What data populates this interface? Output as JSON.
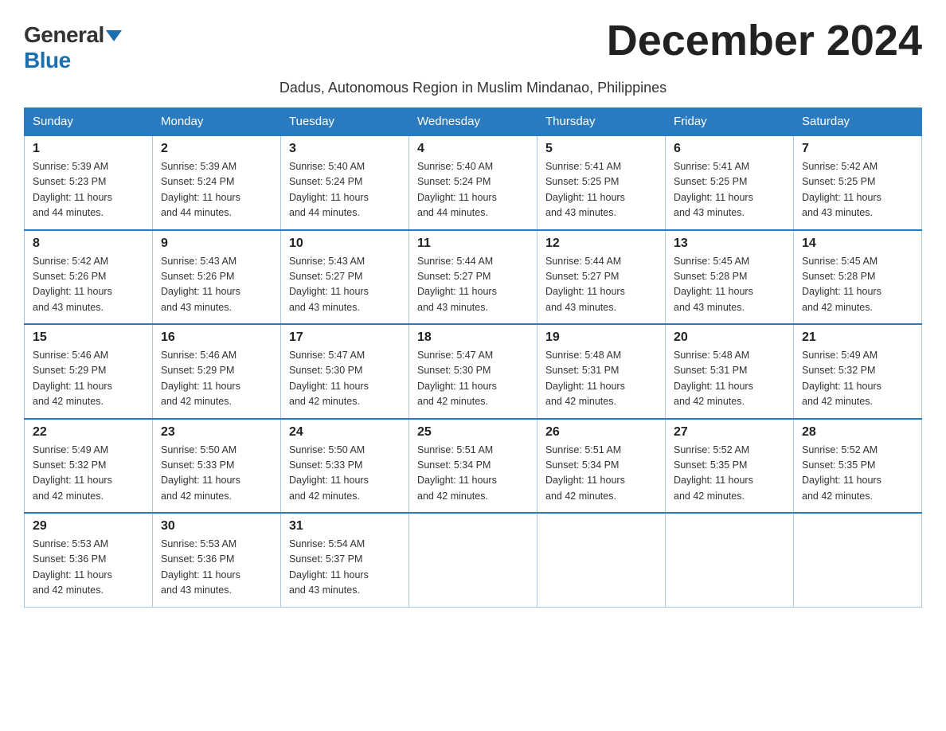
{
  "header": {
    "logo_general": "General",
    "logo_blue": "Blue",
    "month_title": "December 2024",
    "subtitle": "Dadus, Autonomous Region in Muslim Mindanao, Philippines"
  },
  "weekdays": [
    "Sunday",
    "Monday",
    "Tuesday",
    "Wednesday",
    "Thursday",
    "Friday",
    "Saturday"
  ],
  "weeks": [
    [
      {
        "day": "1",
        "sunrise": "5:39 AM",
        "sunset": "5:23 PM",
        "daylight": "11 hours and 44 minutes."
      },
      {
        "day": "2",
        "sunrise": "5:39 AM",
        "sunset": "5:24 PM",
        "daylight": "11 hours and 44 minutes."
      },
      {
        "day": "3",
        "sunrise": "5:40 AM",
        "sunset": "5:24 PM",
        "daylight": "11 hours and 44 minutes."
      },
      {
        "day": "4",
        "sunrise": "5:40 AM",
        "sunset": "5:24 PM",
        "daylight": "11 hours and 44 minutes."
      },
      {
        "day": "5",
        "sunrise": "5:41 AM",
        "sunset": "5:25 PM",
        "daylight": "11 hours and 43 minutes."
      },
      {
        "day": "6",
        "sunrise": "5:41 AM",
        "sunset": "5:25 PM",
        "daylight": "11 hours and 43 minutes."
      },
      {
        "day": "7",
        "sunrise": "5:42 AM",
        "sunset": "5:25 PM",
        "daylight": "11 hours and 43 minutes."
      }
    ],
    [
      {
        "day": "8",
        "sunrise": "5:42 AM",
        "sunset": "5:26 PM",
        "daylight": "11 hours and 43 minutes."
      },
      {
        "day": "9",
        "sunrise": "5:43 AM",
        "sunset": "5:26 PM",
        "daylight": "11 hours and 43 minutes."
      },
      {
        "day": "10",
        "sunrise": "5:43 AM",
        "sunset": "5:27 PM",
        "daylight": "11 hours and 43 minutes."
      },
      {
        "day": "11",
        "sunrise": "5:44 AM",
        "sunset": "5:27 PM",
        "daylight": "11 hours and 43 minutes."
      },
      {
        "day": "12",
        "sunrise": "5:44 AM",
        "sunset": "5:27 PM",
        "daylight": "11 hours and 43 minutes."
      },
      {
        "day": "13",
        "sunrise": "5:45 AM",
        "sunset": "5:28 PM",
        "daylight": "11 hours and 43 minutes."
      },
      {
        "day": "14",
        "sunrise": "5:45 AM",
        "sunset": "5:28 PM",
        "daylight": "11 hours and 42 minutes."
      }
    ],
    [
      {
        "day": "15",
        "sunrise": "5:46 AM",
        "sunset": "5:29 PM",
        "daylight": "11 hours and 42 minutes."
      },
      {
        "day": "16",
        "sunrise": "5:46 AM",
        "sunset": "5:29 PM",
        "daylight": "11 hours and 42 minutes."
      },
      {
        "day": "17",
        "sunrise": "5:47 AM",
        "sunset": "5:30 PM",
        "daylight": "11 hours and 42 minutes."
      },
      {
        "day": "18",
        "sunrise": "5:47 AM",
        "sunset": "5:30 PM",
        "daylight": "11 hours and 42 minutes."
      },
      {
        "day": "19",
        "sunrise": "5:48 AM",
        "sunset": "5:31 PM",
        "daylight": "11 hours and 42 minutes."
      },
      {
        "day": "20",
        "sunrise": "5:48 AM",
        "sunset": "5:31 PM",
        "daylight": "11 hours and 42 minutes."
      },
      {
        "day": "21",
        "sunrise": "5:49 AM",
        "sunset": "5:32 PM",
        "daylight": "11 hours and 42 minutes."
      }
    ],
    [
      {
        "day": "22",
        "sunrise": "5:49 AM",
        "sunset": "5:32 PM",
        "daylight": "11 hours and 42 minutes."
      },
      {
        "day": "23",
        "sunrise": "5:50 AM",
        "sunset": "5:33 PM",
        "daylight": "11 hours and 42 minutes."
      },
      {
        "day": "24",
        "sunrise": "5:50 AM",
        "sunset": "5:33 PM",
        "daylight": "11 hours and 42 minutes."
      },
      {
        "day": "25",
        "sunrise": "5:51 AM",
        "sunset": "5:34 PM",
        "daylight": "11 hours and 42 minutes."
      },
      {
        "day": "26",
        "sunrise": "5:51 AM",
        "sunset": "5:34 PM",
        "daylight": "11 hours and 42 minutes."
      },
      {
        "day": "27",
        "sunrise": "5:52 AM",
        "sunset": "5:35 PM",
        "daylight": "11 hours and 42 minutes."
      },
      {
        "day": "28",
        "sunrise": "5:52 AM",
        "sunset": "5:35 PM",
        "daylight": "11 hours and 42 minutes."
      }
    ],
    [
      {
        "day": "29",
        "sunrise": "5:53 AM",
        "sunset": "5:36 PM",
        "daylight": "11 hours and 42 minutes."
      },
      {
        "day": "30",
        "sunrise": "5:53 AM",
        "sunset": "5:36 PM",
        "daylight": "11 hours and 43 minutes."
      },
      {
        "day": "31",
        "sunrise": "5:54 AM",
        "sunset": "5:37 PM",
        "daylight": "11 hours and 43 minutes."
      },
      null,
      null,
      null,
      null
    ]
  ],
  "labels": {
    "sunrise": "Sunrise:",
    "sunset": "Sunset:",
    "daylight": "Daylight:"
  }
}
